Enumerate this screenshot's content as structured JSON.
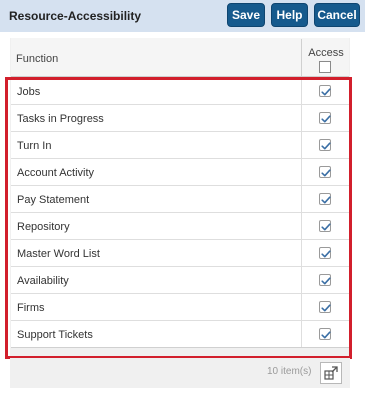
{
  "header": {
    "title": "Resource-Accessibility",
    "save_label": "Save",
    "help_label": "Help",
    "cancel_label": "Cancel"
  },
  "grid": {
    "columns": {
      "function": "Function",
      "access": "Access"
    },
    "header_checkbox_checked": false,
    "rows": [
      {
        "label": "Jobs",
        "checked": true
      },
      {
        "label": "Tasks in Progress",
        "checked": true
      },
      {
        "label": "Turn In",
        "checked": true
      },
      {
        "label": "Account Activity",
        "checked": true
      },
      {
        "label": "Pay Statement",
        "checked": true
      },
      {
        "label": "Repository",
        "checked": true
      },
      {
        "label": "Master Word List",
        "checked": true
      },
      {
        "label": "Availability",
        "checked": true
      },
      {
        "label": "Firms",
        "checked": true
      },
      {
        "label": "Support Tickets",
        "checked": true
      }
    ],
    "item_count": "10 item(s)"
  },
  "colors": {
    "header_bg": "#d5e1f0",
    "button_bg": "#165a8d",
    "highlight": "#d21f2c",
    "check": "#3b6fa5"
  }
}
